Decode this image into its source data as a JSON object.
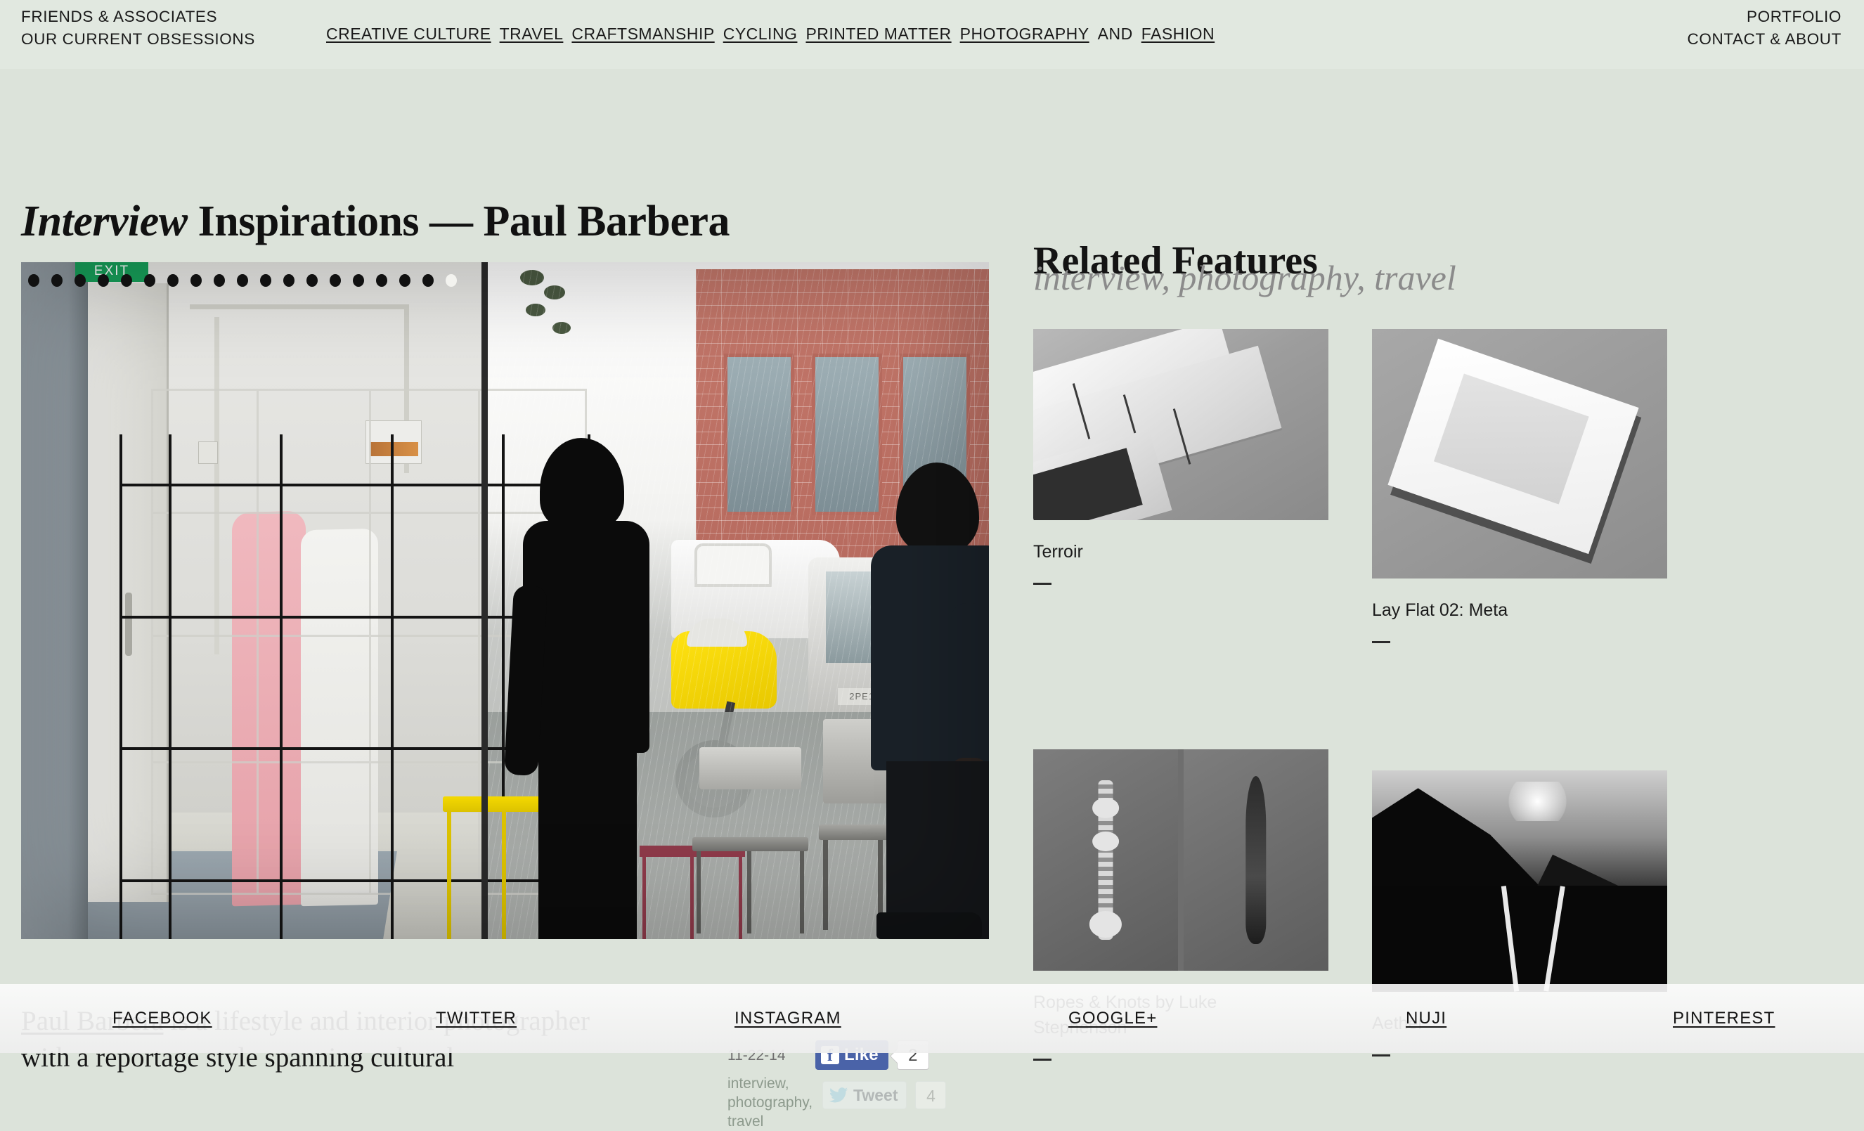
{
  "site": {
    "brand_line1": "FRIENDS & ASSOCIATES",
    "brand_line2": "OUR CURRENT OBSESSIONS",
    "nav": [
      {
        "label": "CREATIVE CULTURE",
        "link": true
      },
      {
        "label": "TRAVEL",
        "link": true
      },
      {
        "label": "CRAFTSMANSHIP",
        "link": true
      },
      {
        "label": "CYCLING",
        "link": true
      },
      {
        "label": "PRINTED MATTER",
        "link": true
      },
      {
        "label": "PHOTOGRAPHY",
        "link": true
      },
      {
        "label": "AND",
        "link": false
      },
      {
        "label": "FASHION",
        "link": true
      }
    ],
    "utility_nav": [
      {
        "label": "PORTFOLIO"
      },
      {
        "label": "CONTACT & ABOUT"
      }
    ]
  },
  "article": {
    "title_italic": "Interview",
    "title_rest": " Inspirations — Paul Barbera",
    "excerpt_link": "Paul Barbera",
    "excerpt_rest": " is a lifestyle and interior photographer with a reportage style spanning cultural",
    "date": "11-22-14",
    "tags": "interview, photography, travel",
    "slideshow": {
      "total_dots": 19,
      "active_index": 19
    }
  },
  "social_widgets": {
    "facebook": {
      "label": "Like",
      "glyph": "f",
      "count": "2"
    },
    "twitter": {
      "label": "Tweet",
      "count": "4"
    }
  },
  "related": {
    "heading": "Related Features",
    "tagline": "interview, photography, travel",
    "items": [
      {
        "caption": "Terroir",
        "dash": "—",
        "art": "t-terroir"
      },
      {
        "caption": "Lay Flat 02: Meta",
        "dash": "—",
        "art": "t-layflat"
      },
      {
        "caption": "Ropes & Knots by Luke Stephenson",
        "dash": "—",
        "art": "t-ropes"
      },
      {
        "caption": "Aether",
        "dash": "—",
        "art": "t-aether"
      }
    ]
  },
  "footer": {
    "links": [
      {
        "label": "FACEBOOK"
      },
      {
        "label": "TWITTER"
      },
      {
        "label": "INSTAGRAM"
      },
      {
        "label": "GOOGLE+"
      },
      {
        "label": "NUJI"
      },
      {
        "label": "PINTEREST"
      }
    ]
  },
  "colors": {
    "header_bg": "#e1e8e0",
    "body_bg": "#dce3da",
    "text": "#151515",
    "muted": "#8b8b8b",
    "facebook_blue": "#4a63a8"
  }
}
